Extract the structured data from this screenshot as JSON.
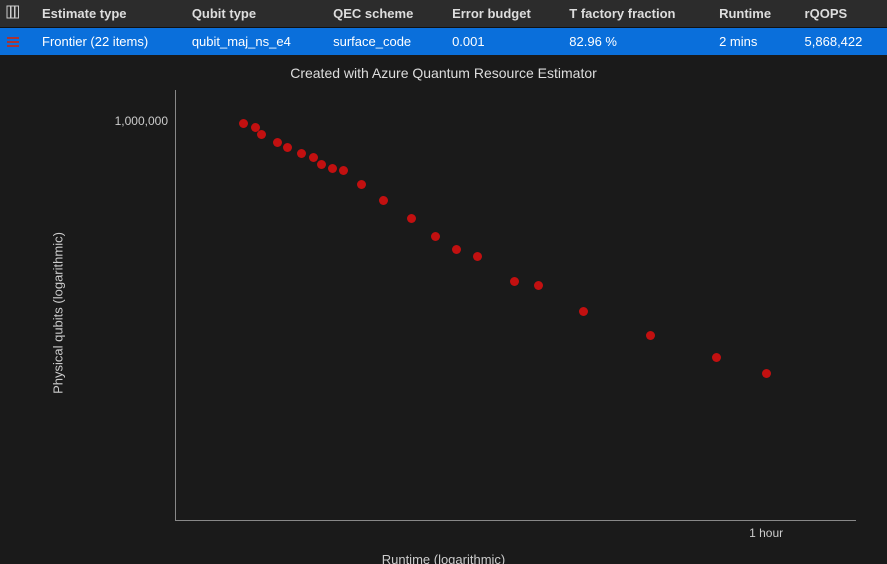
{
  "colors": {
    "accent": "#0a6fdb",
    "point": "#c21010"
  },
  "table": {
    "headers": [
      "Estimate type",
      "Qubit type",
      "QEC scheme",
      "Error budget",
      "T factory fraction",
      "Runtime",
      "rQOPS"
    ],
    "row": {
      "estimate_type": "Frontier (22 items)",
      "qubit_type": "qubit_maj_ns_e4",
      "qec_scheme": "surface_code",
      "error_budget": "0.001",
      "t_factory_fraction": "82.96 %",
      "runtime": "2 mins",
      "rqops": "5,868,422"
    }
  },
  "chart": {
    "title": "Created with Azure Quantum Resource Estimator",
    "xlabel": "Runtime (logarithmic)",
    "ylabel": "Physical qubits (logarithmic)",
    "ytick_label": "1,000,000",
    "xtick_label": "1 hour"
  },
  "chart_data": {
    "type": "scatter",
    "title": "Created with Azure Quantum Resource Estimator",
    "xlabel": "Runtime (logarithmic)",
    "ylabel": "Physical qubits (logarithmic)",
    "x_scale": "log",
    "y_scale": "log",
    "x_unit": "seconds",
    "y_unit": "physical_qubits",
    "series": [
      {
        "name": "Frontier",
        "color": "#c21010",
        "points": [
          {
            "runtime_s": 120,
            "qubits": 980000
          },
          {
            "runtime_s": 130,
            "qubits": 950000
          },
          {
            "runtime_s": 135,
            "qubits": 900000
          },
          {
            "runtime_s": 150,
            "qubits": 850000
          },
          {
            "runtime_s": 160,
            "qubits": 820000
          },
          {
            "runtime_s": 175,
            "qubits": 780000
          },
          {
            "runtime_s": 190,
            "qubits": 760000
          },
          {
            "runtime_s": 200,
            "qubits": 720000
          },
          {
            "runtime_s": 215,
            "qubits": 700000
          },
          {
            "runtime_s": 230,
            "qubits": 690000
          },
          {
            "runtime_s": 260,
            "qubits": 620000
          },
          {
            "runtime_s": 300,
            "qubits": 550000
          },
          {
            "runtime_s": 360,
            "qubits": 480000
          },
          {
            "runtime_s": 420,
            "qubits": 420000
          },
          {
            "runtime_s": 480,
            "qubits": 380000
          },
          {
            "runtime_s": 550,
            "qubits": 360000
          },
          {
            "runtime_s": 700,
            "qubits": 300000
          },
          {
            "runtime_s": 820,
            "qubits": 290000
          },
          {
            "runtime_s": 1100,
            "qubits": 240000
          },
          {
            "runtime_s": 1700,
            "qubits": 200000
          },
          {
            "runtime_s": 2600,
            "qubits": 170000
          },
          {
            "runtime_s": 3600,
            "qubits": 150000
          }
        ]
      }
    ],
    "y_ticks_visible": [
      {
        "value": 1000000,
        "label": "1,000,000"
      }
    ],
    "x_ticks_visible": [
      {
        "value": 3600,
        "label": "1 hour"
      }
    ],
    "plot_x_domain_log10": [
      1.89,
      3.81
    ],
    "plot_y_domain_log10": [
      4.7,
      6.1
    ]
  }
}
